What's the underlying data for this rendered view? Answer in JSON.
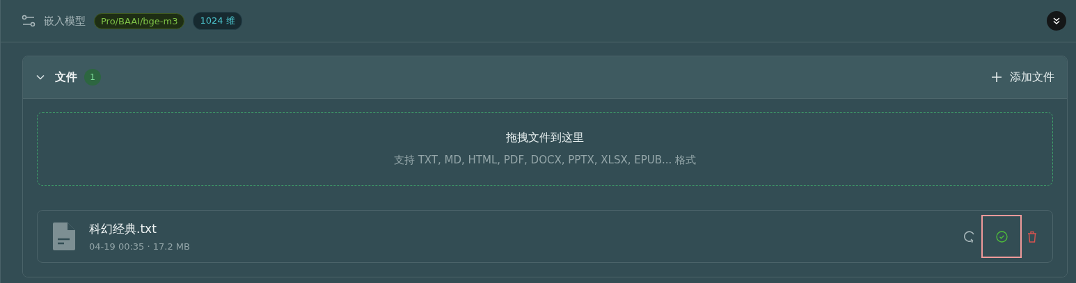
{
  "header": {
    "title": "嵌入模型",
    "model_tag": "Pro/BAAI/bge-m3",
    "dim_tag": "1024 维"
  },
  "files_panel": {
    "expanded": true,
    "title": "文件",
    "count": "1",
    "add_button": "添加文件",
    "dropzone": {
      "title": "拖拽文件到这里",
      "hint": "支持 TXT, MD, HTML, PDF, DOCX, PPTX, XLSX, EPUB... 格式"
    },
    "files": [
      {
        "name": "科幻经典.txt",
        "meta": "04-19 00:35 · 17.2 MB",
        "kind": "done",
        "highlighted": true
      }
    ]
  }
}
